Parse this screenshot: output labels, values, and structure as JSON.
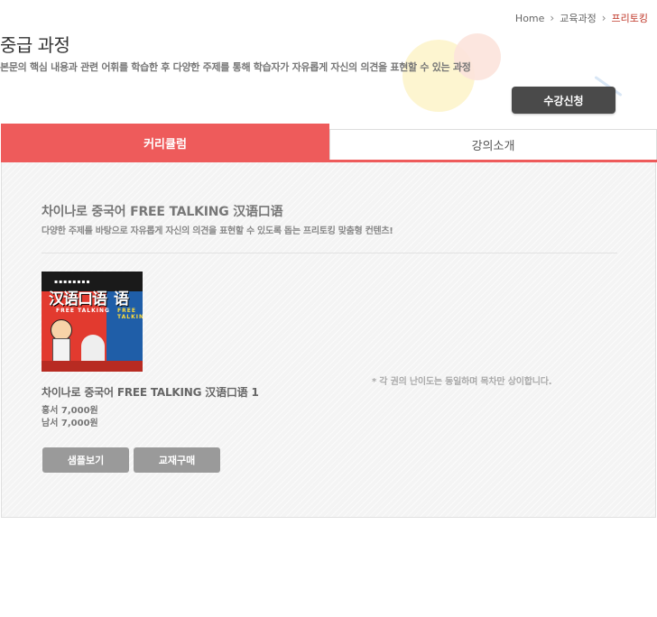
{
  "breadcrumb": {
    "home": "Home",
    "level1": "교육과정",
    "current": "프리토킹"
  },
  "page": {
    "title": "중급 과정",
    "description": "본문의 핵심 내용과 관련 어휘를 학습한 후 다양한 주제를 통해 학습자가 자유롭게 자신의 의견을 표현할 수 있는 과정",
    "enroll_label": "수강신청"
  },
  "tabs": [
    {
      "label": "커리큘럼",
      "active": true
    },
    {
      "label": "강의소개",
      "active": false
    }
  ],
  "section": {
    "title": "차이나로 중국어 FREE TALKING 汉语口语",
    "subtitle": "다양한 주제를 바탕으로 자유롭게 자신의 의견을 표현할 수 있도록 돕는 프리토킹 맞춤형 컨텐츠!"
  },
  "book_cover": {
    "chinese_title": "汉语口语",
    "chinese_title_back": "语",
    "english_title": "FREE TALKING"
  },
  "product": {
    "title": "차이나로 중국어 FREE TALKING 汉语口语 1",
    "prices": [
      {
        "label": "홍서",
        "value": "7,000원"
      },
      {
        "label": "남서",
        "value": "7,000원"
      }
    ],
    "note": "* 각 권의 난이도는 동일하며 목차만 상이합니다.",
    "sample_label": "샘플보기",
    "buy_label": "교재구매"
  },
  "colors": {
    "accent": "#ee5b5b",
    "dark_button": "#4a4a4a",
    "gray_button": "#9a9a9a"
  }
}
